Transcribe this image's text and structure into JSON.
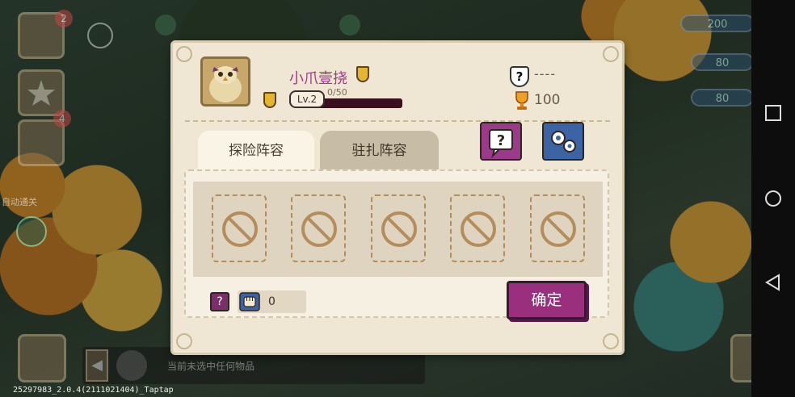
{
  "player": {
    "name": "小爪壹挠",
    "level_label": "Lv.2",
    "xp_text": "0/50",
    "xp_fraction": 0.0,
    "rank_icon_glyph": "?",
    "rank_text": "----",
    "trophy_count": "100"
  },
  "tabs": {
    "active": "探险阵容",
    "inactive": "驻扎阵容"
  },
  "buttons": {
    "help_glyph": "?",
    "settings_icon": "gear-icon",
    "confirm": "确定"
  },
  "team": {
    "slot_count": 5,
    "slot_icon": "forbidden-icon",
    "help_small_glyph": "?",
    "power_value": "0"
  },
  "background": {
    "resources": [
      "200",
      "80",
      "80"
    ],
    "badges": [
      "2",
      "4"
    ],
    "status_text": "当前未选中任何物品",
    "side_label": "自动通关"
  },
  "watermark": "25297983_2.0.4(2111021404)_Taptap",
  "colors": {
    "panel": "#efe7d4",
    "accent_purple": "#9a2f7e",
    "accent_blue": "#3c63a4",
    "name_color": "#a03a8a"
  }
}
